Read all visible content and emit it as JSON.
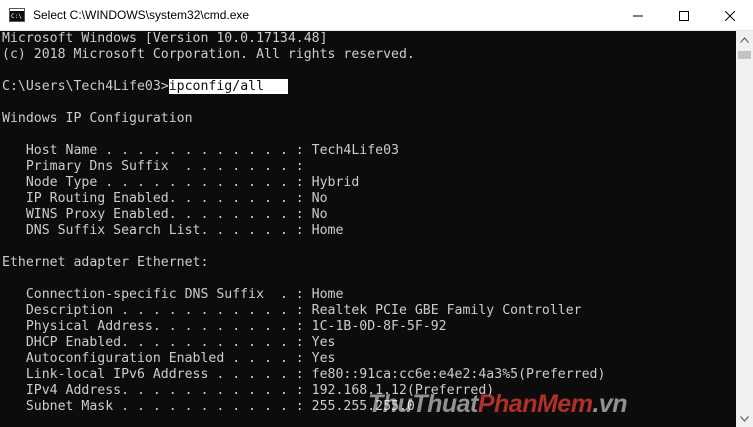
{
  "window": {
    "title": "Select C:\\WINDOWS\\system32\\cmd.exe",
    "icon": "cmd-icon",
    "controls": [
      "minimize-icon",
      "maximize-icon",
      "close-icon"
    ]
  },
  "console": {
    "lines": [
      "Microsoft Windows [Version 10.0.17134.48]",
      "(c) 2018 Microsoft Corporation. All rights reserved.",
      "",
      "",
      "",
      "Windows IP Configuration",
      "",
      "   Host Name . . . . . . . . . . . . : Tech4Life03",
      "   Primary Dns Suffix  . . . . . . . :",
      "   Node Type . . . . . . . . . . . . : Hybrid",
      "   IP Routing Enabled. . . . . . . . : No",
      "   WINS Proxy Enabled. . . . . . . . : No",
      "   DNS Suffix Search List. . . . . . : Home",
      "",
      "Ethernet adapter Ethernet:",
      "",
      "   Connection-specific DNS Suffix  . : Home",
      "   Description . . . . . . . . . . . : Realtek PCIe GBE Family Controller",
      "   Physical Address. . . . . . . . . : 1C-1B-0D-8F-5F-92",
      "   DHCP Enabled. . . . . . . . . . . : Yes",
      "   Autoconfiguration Enabled . . . . : Yes",
      "   Link-local IPv6 Address . . . . . : fe80::91ca:cc6e:e4e2:4a3%5(Preferred)",
      "   IPv4 Address. . . . . . . . . . . : 192.168.1.12(Preferred)",
      "   Subnet Mask . . . . . . . . . . . : 255.255.255.0"
    ],
    "prompt": "C:\\Users\\Tech4Life03>",
    "command": "ipconfig/all   "
  },
  "watermark": {
    "part1": "ThuThuat",
    "part2": "PhanMem",
    "part3": ".vn"
  },
  "colors": {
    "console_bg": "#0c0c0c",
    "console_text": "#cccccc",
    "selection_bg": "#ffffff"
  }
}
